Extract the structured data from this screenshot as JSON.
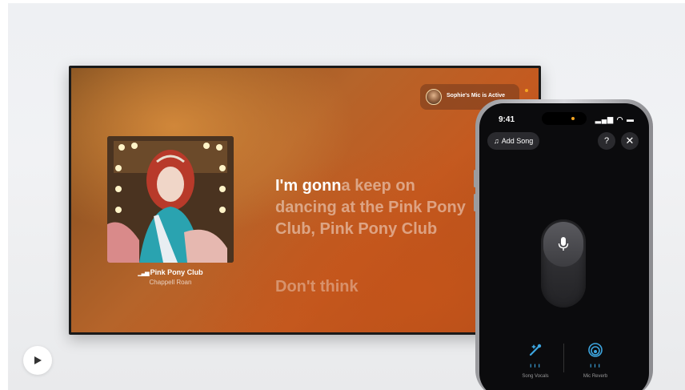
{
  "tv": {
    "mic_status": "Sophie's Mic is Active",
    "now_playing": {
      "title": "Pink Pony Club",
      "artist": "Chappell Roan"
    },
    "lyrics": {
      "line1_sung": "I'm gonn",
      "line1_rest": "a keep on",
      "line2": "dancing at the Pink Pony",
      "line3": "Club, Pink Pony Club",
      "next_line": "Don't think"
    }
  },
  "phone": {
    "status_time": "9:41",
    "status_icons": "signal-icon wifi-icon battery-icon",
    "add_song_label": "Add Song",
    "help_icon": "question-circle-icon",
    "close_icon": "close-icon",
    "mic_icon": "microphone-icon",
    "controls": [
      {
        "label": "Song Vocals",
        "icon": "vocals-wand-icon"
      },
      {
        "label": "Mic Reverb",
        "icon": "reverb-icon"
      }
    ],
    "accent_color": "#3da6e0"
  },
  "video": {
    "play_icon": "play-icon"
  }
}
